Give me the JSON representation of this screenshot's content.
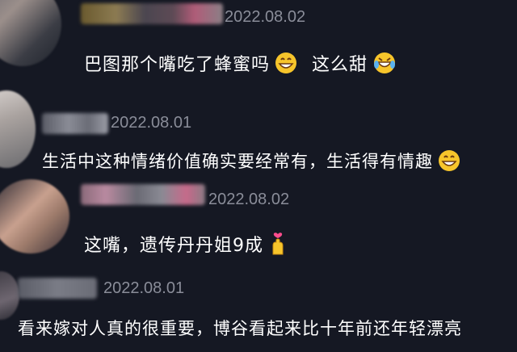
{
  "comments": [
    {
      "date": "2022.08.02",
      "text": "巴图那个嘴吃了蜂蜜吗",
      "text2": "这么甜",
      "emoji1": "grin-emoji",
      "emoji2": "rofl-emoji"
    },
    {
      "date": "2022.08.01",
      "text": "生活中这种情绪价值确实要经常有，生活得有情趣",
      "emoji1": "grin-emoji"
    },
    {
      "date": "2022.08.02",
      "text": "这嘴，遗传丹丹姐9成",
      "emoji1": "finger-heart-emoji"
    },
    {
      "date": "2022.08.01",
      "text": "看来嫁对人真的很重要，博谷看起来比十年前还年轻漂亮"
    }
  ],
  "colors": {
    "background": "#151823",
    "text": "#ffffff",
    "date": "#8a8d99",
    "emoji_yellow": "#f7c52b"
  }
}
